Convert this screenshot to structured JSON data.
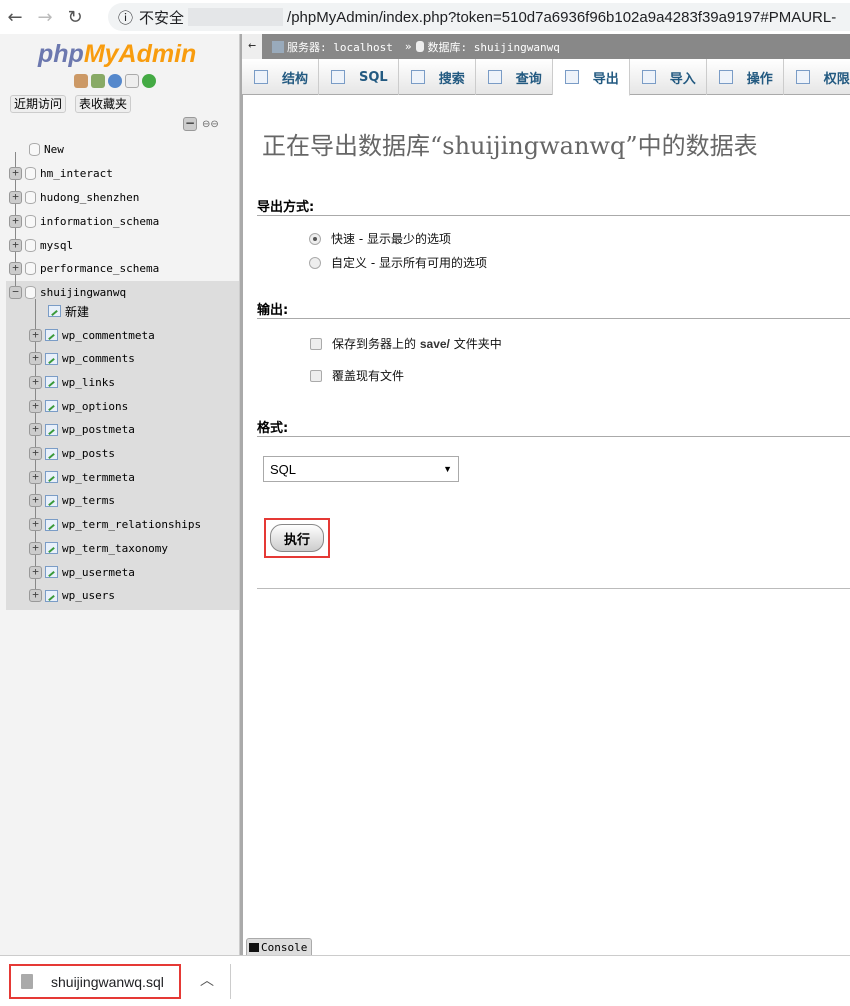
{
  "browser": {
    "security_label": "不安全",
    "url": "/phpMyAdmin/index.php?token=510d7a6936f96b102a9a4283f39a9197#PMAURL-"
  },
  "sidebar": {
    "logo_php": "php",
    "logo_myadmin": "MyAdmin",
    "recent_label": "近期访问",
    "favorites_label": "表收藏夹",
    "databases": [
      {
        "name": "New"
      },
      {
        "name": "hm_interact"
      },
      {
        "name": "hudong_shenzhen"
      },
      {
        "name": "information_schema"
      },
      {
        "name": "mysql"
      },
      {
        "name": "performance_schema"
      },
      {
        "name": "shuijingwanwq"
      }
    ],
    "new_table_label": "新建",
    "tables": [
      "wp_commentmeta",
      "wp_comments",
      "wp_links",
      "wp_options",
      "wp_postmeta",
      "wp_posts",
      "wp_termmeta",
      "wp_terms",
      "wp_term_relationships",
      "wp_term_taxonomy",
      "wp_usermeta",
      "wp_users"
    ]
  },
  "breadcrumb": {
    "server": "服务器: localhost",
    "separator": "»",
    "database": "数据库: shuijingwanwq"
  },
  "tabs": [
    {
      "label": "结构",
      "icon": "structure-icon"
    },
    {
      "label": "SQL",
      "icon": "sql-icon"
    },
    {
      "label": "搜索",
      "icon": "search-icon"
    },
    {
      "label": "查询",
      "icon": "query-icon"
    },
    {
      "label": "导出",
      "icon": "export-icon",
      "active": true
    },
    {
      "label": "导入",
      "icon": "import-icon"
    },
    {
      "label": "操作",
      "icon": "wrench-icon"
    },
    {
      "label": "权限",
      "icon": "privileges-icon"
    }
  ],
  "main": {
    "title": "正在导出数据库“shuijingwanwq”中的数据表",
    "method_heading": "导出方式:",
    "method_quick": "快速 - 显示最少的选项",
    "method_custom": "自定义 - 显示所有可用的选项",
    "output_heading": "输出:",
    "save_prefix": "保存到务器上的",
    "save_dir": "save/",
    "save_suffix": "文件夹中",
    "overwrite_label": "覆盖现有文件",
    "format_heading": "格式:",
    "format_value": "SQL",
    "go_label": "执行"
  },
  "console_label": "Console",
  "download": {
    "filename": "shuijingwanwq.sql"
  }
}
